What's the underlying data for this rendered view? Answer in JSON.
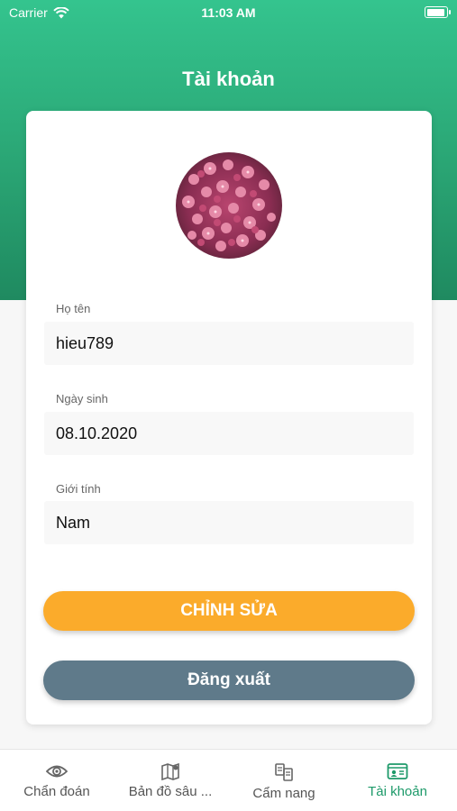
{
  "status_bar": {
    "carrier": "Carrier",
    "time": "11:03 AM"
  },
  "page": {
    "title": "Tài khoản"
  },
  "profile": {
    "fields": [
      {
        "label": "Họ tên",
        "value": "hieu789"
      },
      {
        "label": "Ngày sinh",
        "value": "08.10.2020"
      },
      {
        "label": "Giới tính",
        "value": "Nam"
      }
    ]
  },
  "buttons": {
    "edit": "CHỈNH SỬA",
    "logout": "Đăng xuất"
  },
  "tabs": [
    {
      "label": "Chẩn đoán",
      "icon": "eye-icon"
    },
    {
      "label": "Bản đồ sâu ...",
      "icon": "map-icon"
    },
    {
      "label": "Cẩm nang",
      "icon": "handbook-icon"
    },
    {
      "label": "Tài khoản",
      "icon": "id-card-icon",
      "active": true
    }
  ],
  "colors": {
    "header": "#2aa574",
    "edit_button": "#fbab2b",
    "logout_button": "#5f7a8a",
    "active_tab": "#1e9a6a"
  }
}
